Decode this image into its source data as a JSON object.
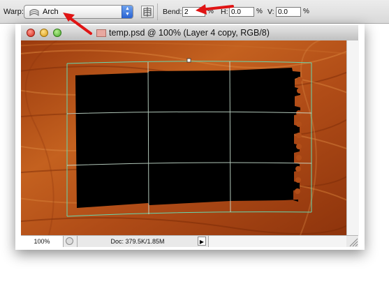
{
  "options_bar": {
    "warp_label": "Warp:",
    "warp_value": "Arch",
    "bend_label": "Bend:",
    "bend_value": "2",
    "bend_unit": "%",
    "h_label": "H:",
    "h_value": "0.0",
    "h_unit": "%",
    "v_label": "V:",
    "v_value": "0.0",
    "v_unit": "%"
  },
  "window": {
    "title": "temp.psd @ 100% (Layer 4 copy, RGB/8)"
  },
  "status_bar": {
    "zoom": "100%",
    "doc_info": "Doc: 379.5K/1.85M"
  },
  "annotations": {
    "arrow_color": "#e01414"
  },
  "colors": {
    "warp_grid": "#66d8b0",
    "wood_base": "#b04a16",
    "shape_fill": "#000000"
  }
}
